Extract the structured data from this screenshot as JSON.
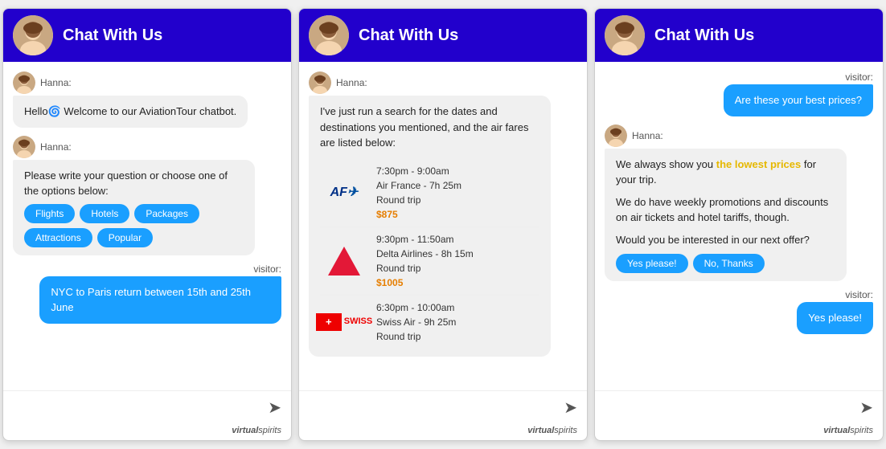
{
  "header": {
    "title": "Chat With Us",
    "avatar_alt": "Hanna agent avatar"
  },
  "panel1": {
    "messages": [
      {
        "type": "agent",
        "sender": "Hanna:",
        "text": "Hello🌀 Welcome to our AviationTour chatbot."
      },
      {
        "type": "agent",
        "sender": "Hanna:",
        "text": "Please write your question or choose one of the options below:"
      }
    ],
    "tags": [
      "Flights",
      "Hotels",
      "Packages",
      "Attractions",
      "Popular"
    ],
    "visitor_label": "visitor:",
    "visitor_msg": "NYC to Paris return between 15th and 25th June"
  },
  "panel2": {
    "agent_sender": "Hanna:",
    "agent_intro": "I've just run a search for the dates and destinations you mentioned, and the air fares are listed below:",
    "flights": [
      {
        "airline": "Air France",
        "logo_type": "af",
        "time": "7:30pm - 9:00am",
        "duration": "Air France - 7h 25m",
        "type": "Round trip",
        "price": "$875"
      },
      {
        "airline": "Delta Airlines",
        "logo_type": "delta",
        "time": "9:30pm - 11:50am",
        "duration": "Delta Airlines - 8h 15m",
        "type": "Round trip",
        "price": "$1005"
      },
      {
        "airline": "Swiss Air",
        "logo_type": "swiss",
        "time": "6:30pm - 10:00am",
        "duration": "Swiss Air - 9h 25m",
        "type": "Round trip",
        "price": ""
      }
    ]
  },
  "panel3": {
    "visitor_label": "visitor:",
    "visitor_question": "Are these your best prices?",
    "agent_sender": "Hanna:",
    "agent_response_parts": [
      "We always show you the lowest prices for your trip.",
      "We do have weekly promotions and discounts on air tickets and hotel tariffs, though.",
      "Would you be interested in our next offer?"
    ],
    "buttons": [
      "Yes please!",
      "No, Thanks"
    ],
    "visitor_label2": "visitor:",
    "visitor_reply": "Yes please!"
  },
  "footer": {
    "brand": "virtual",
    "brand2": "spirits",
    "send_icon": "➤"
  }
}
